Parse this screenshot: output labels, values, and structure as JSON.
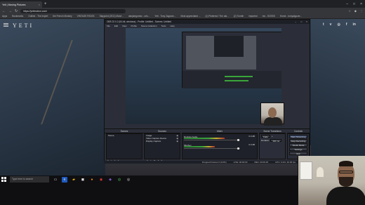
{
  "browser": {
    "active_tab": "Yeti | Moving Pictures",
    "tabs": [
      "YouTube",
      "Outline - The expert",
      "the French Monkey",
      "VINTAGE RIGGS",
      "Slaypoint (2011) Marvi...",
      "danjaiegomez - urls...",
      "Yeti - Tony Zagoran...",
      "Most appreciated ...",
      "(1) Pinterest / The dai...",
      "(2) Tumblr",
      "imported",
      "res - SOSSS",
      "Home - tomyalgozer..."
    ],
    "url": "https://yetimotion.com/",
    "bookmarks": [
      "Apps",
      "Bookmarks",
      "Outline - The expert",
      "the French Monkey",
      "VINTAGE RIGGS",
      "Slaypoint (2011) Marvi...",
      "danjaiegomez - urls...",
      "Yeti - Tony Zagoran...",
      "Most appreciated ...",
      "(1) Pinterest / The dai...",
      "(2) Tumblr",
      "imported",
      "res - SOSSS",
      "Home - tomyalgozer..."
    ]
  },
  "site": {
    "logo": "YETI",
    "socials": [
      "twitter-icon",
      "vimeo-icon",
      "instagram-icon",
      "facebook-icon",
      "linkedin-icon"
    ]
  },
  "obs": {
    "title": "OBS 22.0.2 (64-bit, windows) - Profile: Untitled - Scenes: Untitled",
    "menu": [
      "File",
      "Edit",
      "View",
      "Profile",
      "Scene Collection",
      "Tools",
      "Help"
    ],
    "panels": {
      "scenes": "Scenes",
      "sources": "Sources",
      "mixer": "Mixer",
      "transitions": "Scene Transitions",
      "controls": "Controls"
    },
    "scenes": [
      "Scene"
    ],
    "sources": [
      "Image",
      "Video Capture Device",
      "Display Capture"
    ],
    "mixer": [
      {
        "name": "Desktop Audio",
        "db": "0.0 dB",
        "level": 0.72
      },
      {
        "name": "Mic/Aux",
        "db": "0.0 dB",
        "level": 0.55
      }
    ],
    "transition": {
      "value": "Fade",
      "duration_label": "Duration",
      "duration": "300 ms"
    },
    "controls": [
      "Start Streaming",
      "Stop Recording",
      "Studio Mode",
      "Settings",
      "Exit"
    ],
    "status": {
      "dropped": "Dropped Frames 0 (0.0%)",
      "live": "LIVE: 00:00:00",
      "rec": "REC: 00:00:29",
      "cpu": "CPU: 9.2%, 30.00 fps"
    }
  },
  "taskbar": {
    "search_placeholder": "Type here to search"
  }
}
